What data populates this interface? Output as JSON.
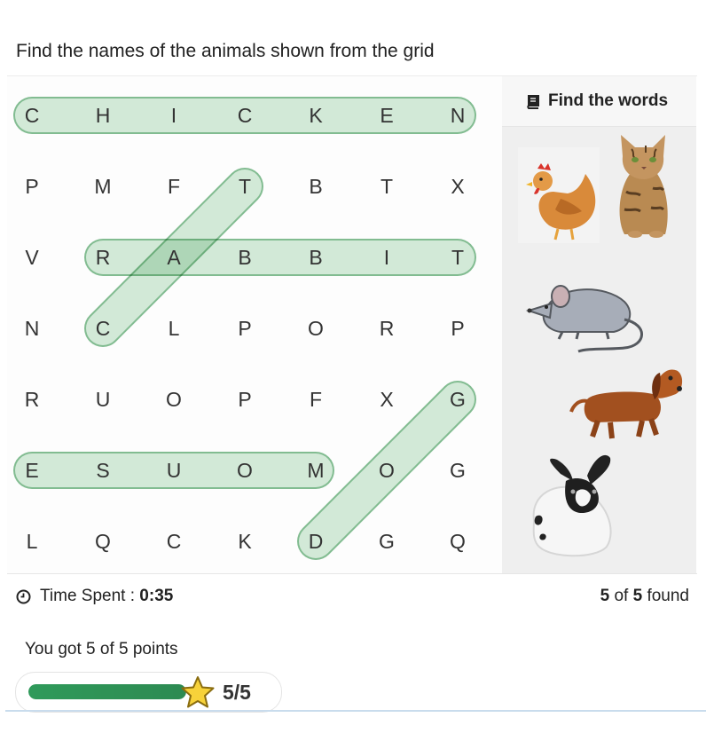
{
  "question": "Find the names of the animals shown from the grid",
  "grid": [
    [
      "C",
      "H",
      "I",
      "C",
      "K",
      "E",
      "N"
    ],
    [
      "P",
      "M",
      "F",
      "T",
      "B",
      "T",
      "X"
    ],
    [
      "V",
      "R",
      "A",
      "B",
      "B",
      "I",
      "T"
    ],
    [
      "N",
      "C",
      "L",
      "P",
      "O",
      "R",
      "P"
    ],
    [
      "R",
      "U",
      "O",
      "P",
      "F",
      "X",
      "G"
    ],
    [
      "E",
      "S",
      "U",
      "O",
      "M",
      "O",
      "G"
    ],
    [
      "L",
      "Q",
      "C",
      "K",
      "D",
      "G",
      "Q"
    ]
  ],
  "found_words": [
    {
      "word": "CHICKEN",
      "from": [
        0,
        0
      ],
      "to": [
        0,
        6
      ]
    },
    {
      "word": "RABBIT",
      "from": [
        2,
        1
      ],
      "to": [
        2,
        6
      ]
    },
    {
      "word": "CAT",
      "from": [
        3,
        1
      ],
      "to": [
        1,
        3
      ]
    },
    {
      "word": "MOUSE",
      "from": [
        5,
        4
      ],
      "to": [
        5,
        0
      ]
    },
    {
      "word": "DOG",
      "from": [
        6,
        4
      ],
      "to": [
        4,
        6
      ]
    }
  ],
  "highlight_color": "#8fc79f",
  "sidebar": {
    "title": "Find the words",
    "icon": "book-icon",
    "pictures": [
      "chicken",
      "cat",
      "mouse",
      "dog",
      "rabbit"
    ]
  },
  "status": {
    "time_label": "Time Spent : ",
    "time_value": "0:35",
    "found_count": "5",
    "found_of": " of ",
    "found_total": "5",
    "found_suffix": " found"
  },
  "score": {
    "text": "You got 5 of 5 points",
    "display": "5/5",
    "progress": 1.0,
    "accent": "#2f9a5a"
  }
}
